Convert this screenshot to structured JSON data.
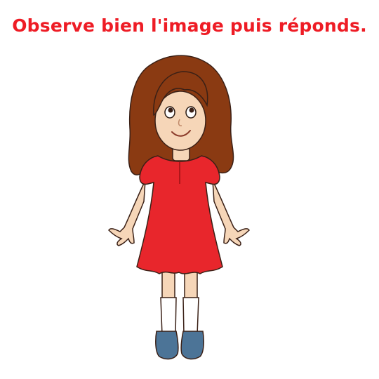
{
  "instruction": {
    "text": "Observe bien l'image puis réponds.",
    "color": "#ee1c25"
  },
  "illustration": {
    "subject": "girl-figure",
    "colors": {
      "hair": "#8a3a12",
      "skin": "#f6d6b8",
      "dress": "#e8262c",
      "socks": "#ffffff",
      "shoes": "#4c7497"
    }
  }
}
